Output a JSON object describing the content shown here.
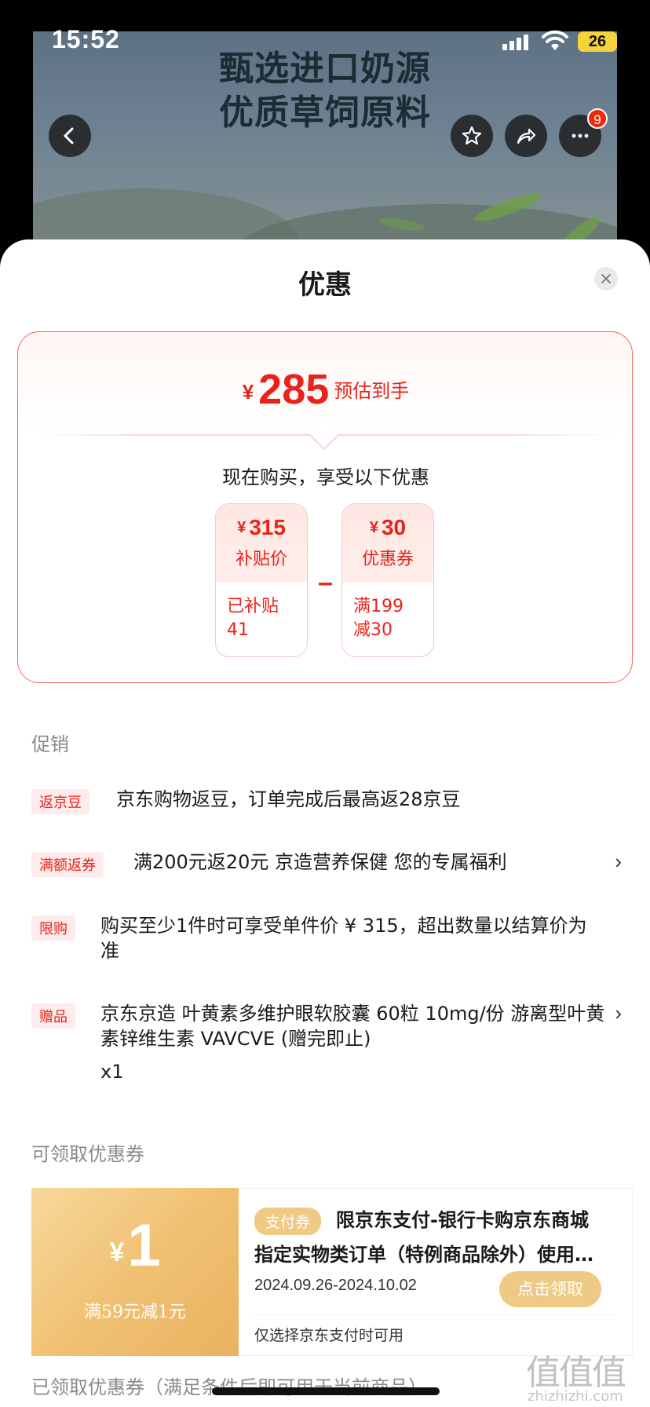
{
  "status_bar": {
    "time": "15:52",
    "battery": "26"
  },
  "banner": {
    "line1": "甄选进口奶源",
    "line2": "优质草饲原料",
    "more_badge": "9"
  },
  "sheet": {
    "title": "优惠"
  },
  "price": {
    "currency": "¥",
    "estimate": "285",
    "estimate_label": "预估到手",
    "buy_now_text": "现在购买，享受以下优惠",
    "subsidy": {
      "currency": "¥",
      "value": "315",
      "name": "补贴价",
      "detail_line1": "已补贴",
      "detail_line2": "41"
    },
    "coupon": {
      "currency": "¥",
      "value": "30",
      "name": "优惠券",
      "detail_line1": "满199",
      "detail_line2": "减30"
    },
    "operator": "–"
  },
  "promotions": {
    "title": "促销",
    "items": [
      {
        "tag": "返京豆",
        "text": "京东购物返豆，订单完成后最高返28京豆",
        "has_arrow": false
      },
      {
        "tag": "满额返券",
        "text": "满200元返20元 京造营养保健 您的专属福利",
        "has_arrow": true
      },
      {
        "tag": "限购",
        "text": "购买至少1件时可享受单件价 ¥ 315，超出数量以结算价为准",
        "has_arrow": false
      },
      {
        "tag": "赠品",
        "text": "京东京造 叶黄素多维护眼软胶囊 60粒 10mg/份 游离型叶黄素锌维生素 VAVCVE (赠完即止)",
        "qty": "x1",
        "has_arrow": true
      }
    ],
    "arrow": "›"
  },
  "available_coupons": {
    "title": "可领取优惠券",
    "coupon": {
      "currency": "¥",
      "amount": "1",
      "condition": "满59元减1元",
      "tag": "支付券",
      "title_line1": "限京东支付-银行卡购京东商城",
      "title_line2": "指定实物类订单（特例商品除外）使用…",
      "date": "2024.09.26-2024.10.02",
      "button": "点击领取",
      "note": "仅选择京东支付时可用"
    }
  },
  "claimed_coupons": {
    "title": "已领取优惠券（满足条件后即可用于当前商品）"
  },
  "watermark": {
    "main": "值值值",
    "sub": "zhizhizhi.com"
  },
  "colors": {
    "accent": "#e8231a",
    "coupon_gold": "#eeca84"
  }
}
